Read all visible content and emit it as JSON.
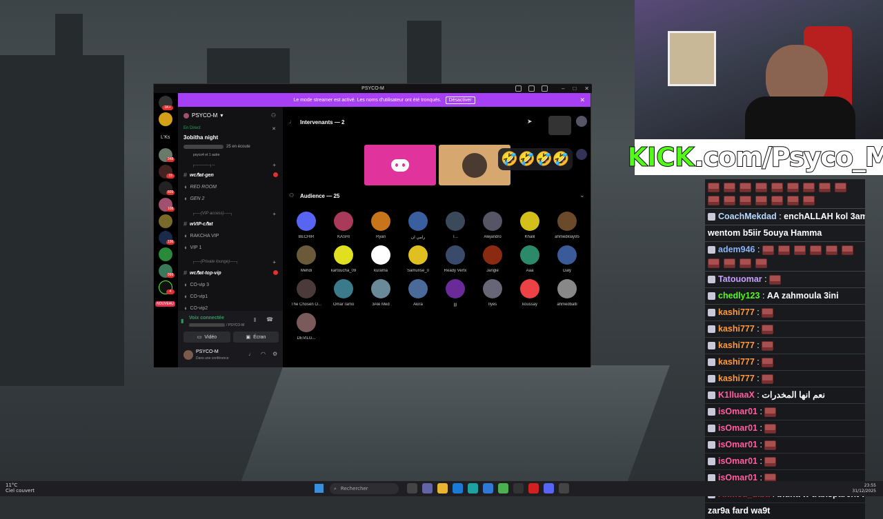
{
  "window": {
    "title": "PSYCO-M"
  },
  "banner": {
    "text": "Le mode streamer est activé. Les noms d'utilisateur ont été tronqués.",
    "button": "Désactiver"
  },
  "servers": {
    "top_badge": "1K+",
    "lks": "L'Ks",
    "badges": [
      "348",
      "15",
      "609",
      "108",
      "136",
      "999",
      "4"
    ],
    "new_label": "NOUVEAU"
  },
  "channels": {
    "server_name": "PSYCO-M",
    "live_label": "En Direct",
    "event_title": "3obitha night",
    "event_meta": "25 en écoute",
    "event_sub": "psyco4 et 1 autre",
    "cat1": "┌─────╮─",
    "items1": [
      "ᴡcℏat-gen",
      "RED ROOM",
      "GEN 2"
    ],
    "cat2": "┌──(VIP access)──┐",
    "items2": [
      "ᴡVIP-cℏat",
      "RAKCHA VIP",
      "VIP 1"
    ],
    "cat3": "┌──(Private lounge)──┐",
    "items3": [
      "ᴡcℏat-top-vip",
      "CO-vip 3",
      "CO-vip1",
      "CO-vip2"
    ],
    "voice_connected": "Voix connectée",
    "voice_sub": "/ PSYCO-M",
    "video_btn": "Vidéo",
    "screen_btn": "Écran",
    "user_name": "PSYCO-M",
    "user_status": "Dans une conférence"
  },
  "stage": {
    "speakers_label": "Intervenants — 2",
    "audience_label": "Audience — 25",
    "reactions": "🤣🤣🤣🤣",
    "audience": [
      "BECHIR",
      "KASHI",
      "Ryan",
      "رامي ان",
      "T...",
      "Alejandro",
      "Khalil",
      "ahmedklay95",
      "Mehdi",
      "kartoucha_09",
      "kurama",
      "Samurise_0",
      "Ready Vertx",
      "Jangle",
      "Aaa",
      "Daly",
      "The Chosen O...",
      "Omar ramo",
      "3Alé Med",
      "Akira",
      "jjj",
      "Ilyes",
      "koussay",
      "ahmedbalti",
      "DEVILG..."
    ]
  },
  "kick": {
    "prefix": "KICK",
    "domain": ".com/Psyco_M"
  },
  "chat": [
    {
      "user": "",
      "text": "",
      "emotes": 16,
      "color": "#ffffff"
    },
    {
      "user": "CoachMekdad",
      "text": "enchALLAH kol 3am",
      "emotes": 0,
      "color": "#b8d8ff"
    },
    {
      "user": "",
      "text": "wentom b5iir 5ouya Hamma",
      "emotes": 0,
      "color": "#ffffff"
    },
    {
      "user": "adem946",
      "text": "",
      "emotes": 10,
      "color": "#8ab4f8"
    },
    {
      "user": "Tatouomar",
      "text": "",
      "emotes": 1,
      "color": "#c8a0ff"
    },
    {
      "user": "chedly123",
      "text": "AA zahmoula 3ini",
      "emotes": 0,
      "color": "#53fc18"
    },
    {
      "user": "kashi777",
      "text": "",
      "emotes": 1,
      "color": "#ff9a3c"
    },
    {
      "user": "kashi777",
      "text": "",
      "emotes": 1,
      "color": "#ff9a3c"
    },
    {
      "user": "kashi777",
      "text": "",
      "emotes": 1,
      "color": "#ff9a3c"
    },
    {
      "user": "kashi777",
      "text": "",
      "emotes": 1,
      "color": "#ff9a3c"
    },
    {
      "user": "kashi777",
      "text": "",
      "emotes": 1,
      "color": "#ff9a3c"
    },
    {
      "user": "K1lluaaX",
      "text": "نعم انها المخدرات",
      "emotes": 0,
      "color": "#ff5fa2"
    },
    {
      "user": "isOmar01",
      "text": "",
      "emotes": 1,
      "color": "#ff5fa2"
    },
    {
      "user": "isOmar01",
      "text": "",
      "emotes": 1,
      "color": "#ff5fa2"
    },
    {
      "user": "isOmar01",
      "text": "",
      "emotes": 1,
      "color": "#ff5fa2"
    },
    {
      "user": "isOmar01",
      "text": "",
      "emotes": 1,
      "color": "#ff5fa2"
    },
    {
      "user": "isOmar01",
      "text": "",
      "emotes": 1,
      "color": "#ff5fa2"
    },
    {
      "user": "Ahmed_diba",
      "text": "bidha w transparent w",
      "emotes": 0,
      "color": "#e0303a"
    },
    {
      "user": "",
      "text": "zar9a fard wa9t",
      "emotes": 0,
      "color": "#ffffff"
    }
  ],
  "taskbar": {
    "weather_temp": "11°C",
    "weather_desc": "Ciel couvert",
    "search_placeholder": "Rechercher",
    "time": "23:55",
    "date": "31/12/2025"
  }
}
